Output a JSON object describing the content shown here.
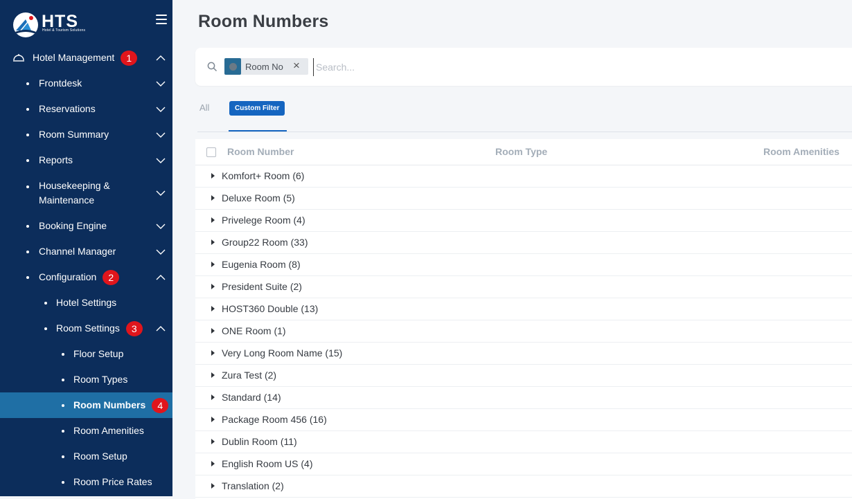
{
  "brand": {
    "name": "HTS",
    "tagline": "Hotel & Tourism Solutions"
  },
  "sidebar": {
    "items": [
      {
        "label": "Hotel Management",
        "badge": "1",
        "expanded": true
      },
      {
        "label": "Frontdesk"
      },
      {
        "label": "Reservations"
      },
      {
        "label": "Room Summary"
      },
      {
        "label": "Reports"
      },
      {
        "label": "Housekeeping &",
        "label2": "Maintenance"
      },
      {
        "label": "Booking Engine"
      },
      {
        "label": "Channel Manager"
      },
      {
        "label": "Configuration",
        "badge": "2",
        "expanded": true
      },
      {
        "label": "Hotel Settings"
      },
      {
        "label": "Room Settings",
        "badge": "3",
        "expanded": true
      },
      {
        "label": "Floor Setup"
      },
      {
        "label": "Room Types"
      },
      {
        "label": "Room Numbers",
        "badge": "4",
        "active": true
      },
      {
        "label": "Room Amenities"
      },
      {
        "label": "Room Setup"
      },
      {
        "label": "Room Price Rates"
      }
    ]
  },
  "page": {
    "title": "Room Numbers"
  },
  "search": {
    "chip_label": "Room No",
    "chip_close": "×",
    "placeholder": "Search..."
  },
  "tabs": {
    "all": "All",
    "custom": "Custom Filter"
  },
  "table": {
    "columns": [
      "Room Number",
      "Room Type",
      "Room Amenities"
    ],
    "groups": [
      "Komfort+ Room (6)",
      "Deluxe Room (5)",
      "Privelege Room (4)",
      "Group22 Room (33)",
      "Eugenia Room (8)",
      "President Suite (2)",
      "HOST360 Double (13)",
      "ONE Room (1)",
      "Very Long Room Name (15)",
      "Zura Test (2)",
      "Standard (14)",
      "Package Room 456 (16)",
      "Dublin Room (11)",
      "English Room US (4)",
      "Translation (2)"
    ]
  },
  "colors": {
    "sidebar": "#0c2d5b",
    "active": "#1f6fa5",
    "badge": "#e0151c",
    "accent": "#1565c0"
  }
}
